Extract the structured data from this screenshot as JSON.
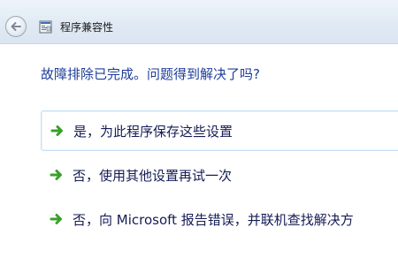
{
  "window": {
    "title": "程序兼容性"
  },
  "icons": {
    "back": "back-arrow-icon",
    "app": "program-compatibility-icon",
    "option": "green-arrow-icon"
  },
  "colors": {
    "question": "#1e3d9a",
    "option_text": "#151c55",
    "arrow": "#3aa02a",
    "titlebar": "#dfe9f3"
  },
  "main": {
    "question": "故障排除已完成。问题得到解决了吗?",
    "options": [
      {
        "label": "是，为此程序保存这些设置"
      },
      {
        "label": "否，使用其他设置再试一次"
      },
      {
        "label": "否，向 Microsoft 报告错误，并联机查找解决方"
      }
    ]
  }
}
